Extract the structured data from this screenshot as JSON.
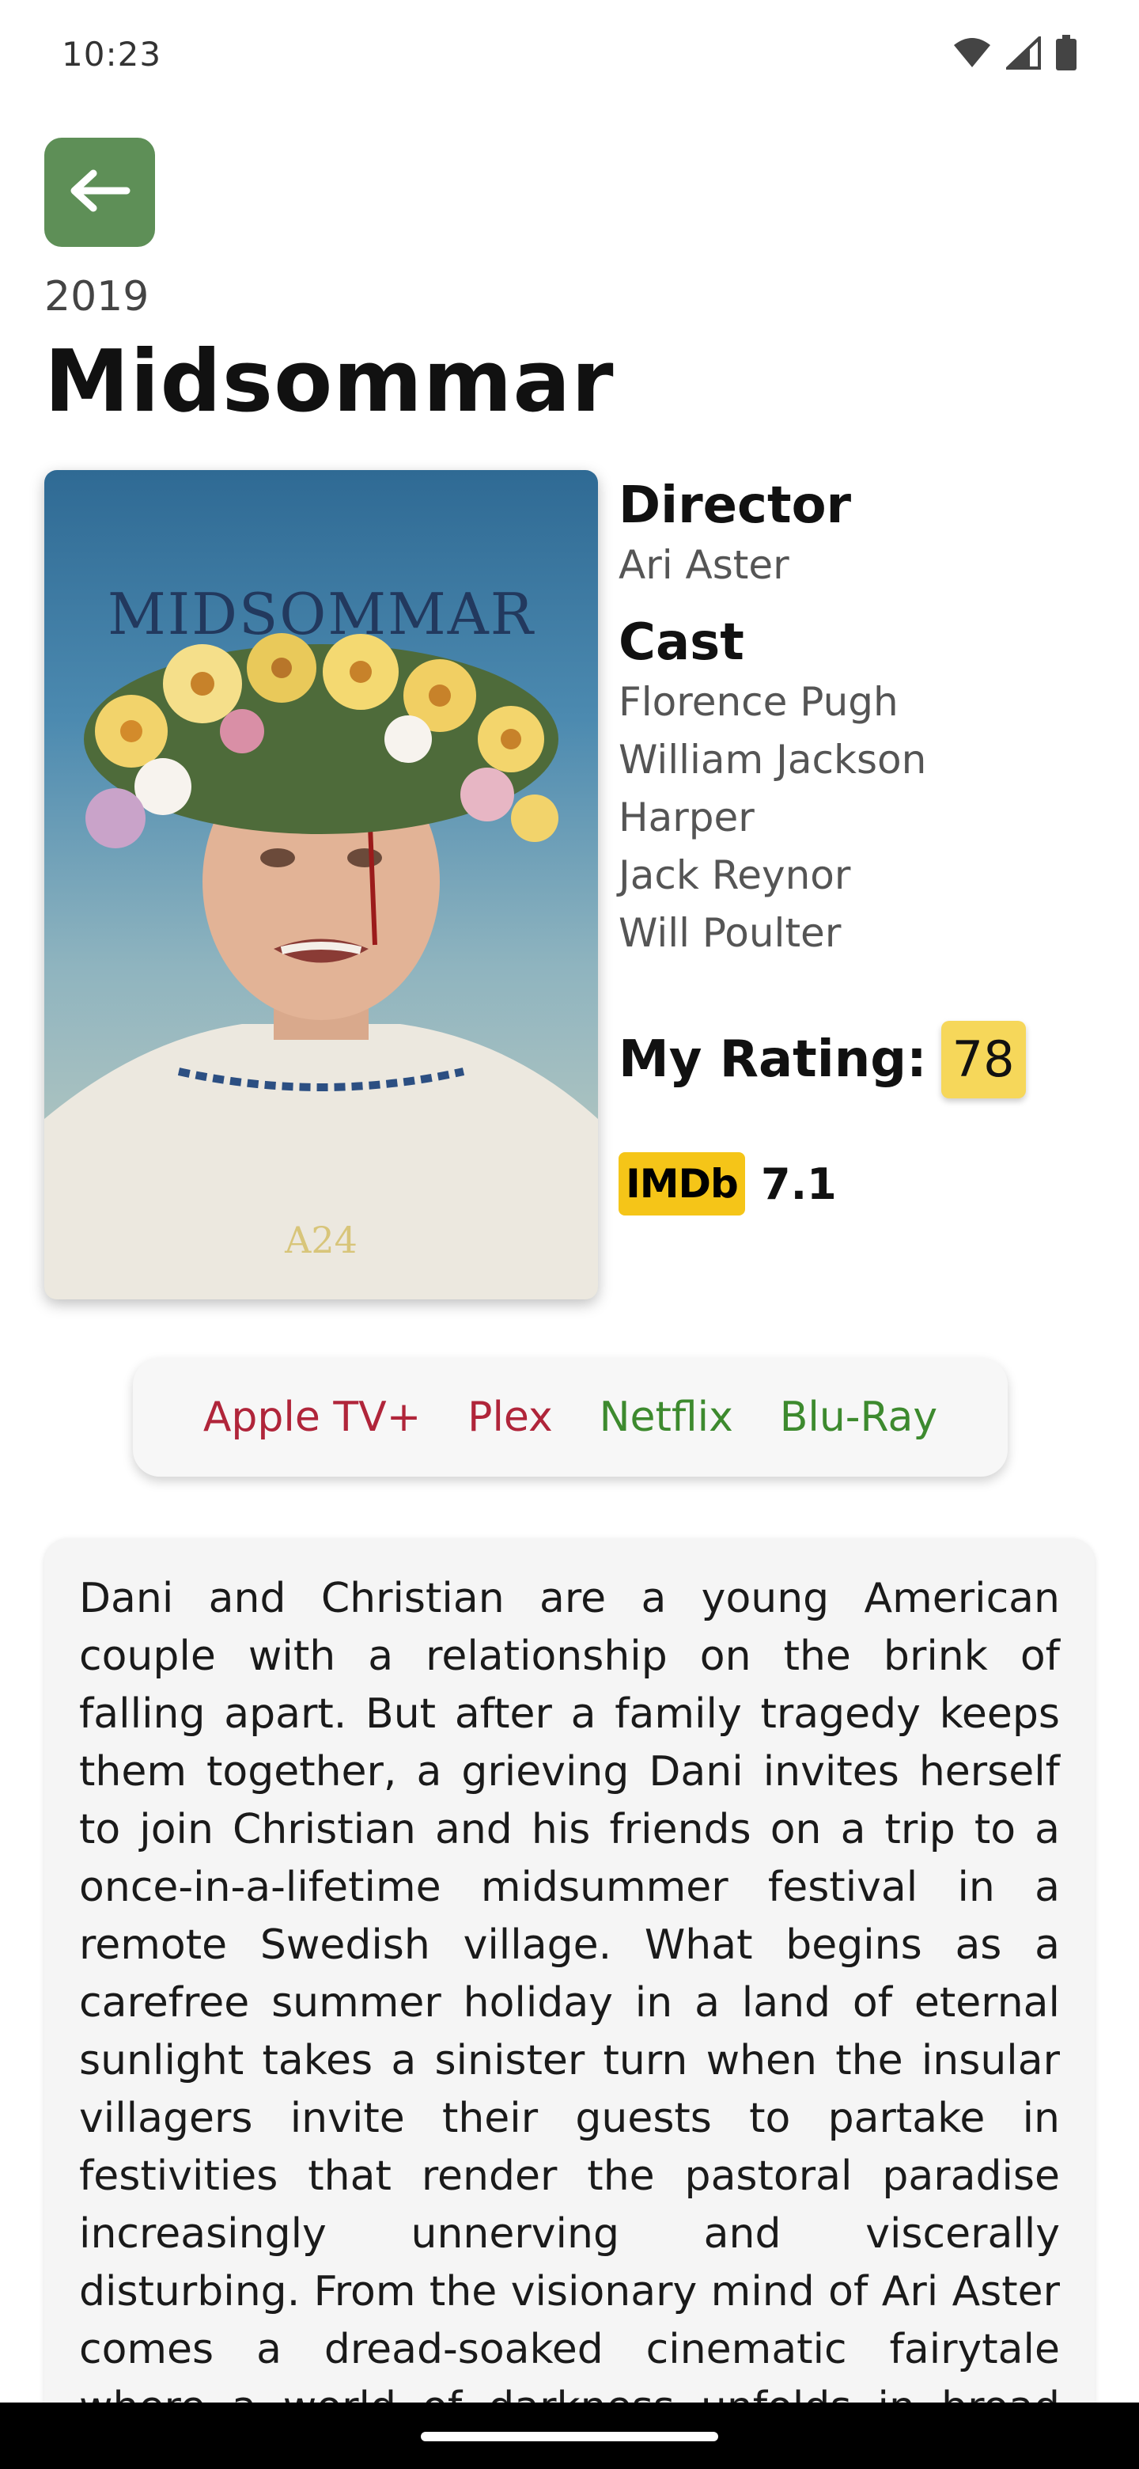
{
  "status_bar": {
    "time": "10:23",
    "icons": [
      "wifi-icon",
      "signal-icon",
      "battery-icon"
    ]
  },
  "movie": {
    "year": "2019",
    "title": "Midsommar",
    "poster": {
      "title_text": "MIDSOMMAR",
      "studio_text": "A24"
    },
    "director_heading": "Director",
    "director": "Ari Aster",
    "cast_heading": "Cast",
    "cast": [
      "Florence Pugh",
      "William Jackson",
      "Harper",
      "Jack Reynor",
      "Will Poulter"
    ],
    "my_rating_label": "My Rating:",
    "my_rating": "78",
    "imdb_logo": "IMDb",
    "imdb_score": "7.1"
  },
  "services": [
    {
      "label": "Apple TV+",
      "available": false
    },
    {
      "label": "Plex",
      "available": false
    },
    {
      "label": "Netflix",
      "available": true
    },
    {
      "label": "Blu-Ray",
      "available": true
    }
  ],
  "synopsis": "Dani and Christian are a young American couple with a relationship on the brink of falling apart. But after a family tragedy keeps them together, a grieving Dani invites herself to join Christian and his friends on a trip to a once-in-a-lifetime midsummer festival in a remote Swedish village. What begins as a carefree summer holiday in a land of eternal sunlight takes a sinister turn when the insular villagers invite their guests to partake in festivities that render the pastoral paradise increasingly unnerving and viscerally disturbing. From the visionary mind of Ari Aster comes a dread-soaked cinematic fairytale where a world of darkness unfolds in broad daylight.",
  "colors": {
    "back_button": "#5e8f57",
    "rating_badge": "#f6d75a",
    "imdb_yellow": "#f5c518",
    "service_unavailable": "#b0253a",
    "service_available": "#3d8a2e"
  }
}
